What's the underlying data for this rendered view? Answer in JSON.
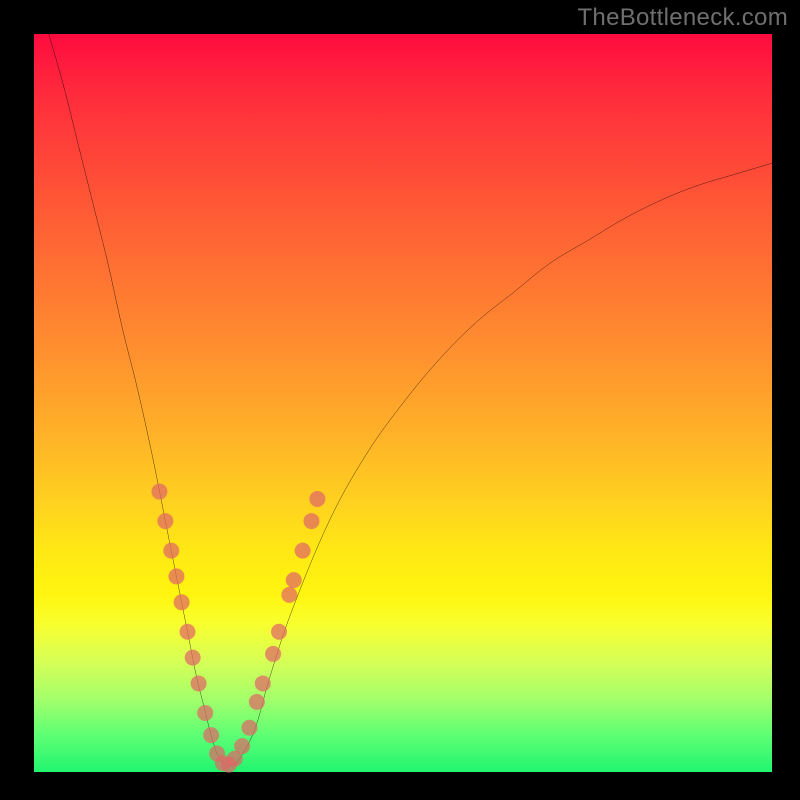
{
  "watermark": "TheBottleneck.com",
  "chart_data": {
    "type": "line",
    "title": "",
    "xlabel": "",
    "ylabel": "",
    "xlim": [
      0,
      100
    ],
    "ylim": [
      0,
      100
    ],
    "series": [
      {
        "name": "bottleneck-curve",
        "color": "#000000",
        "x": [
          2,
          4,
          6,
          8,
          10,
          12,
          14,
          16,
          18,
          19,
          20,
          21,
          22,
          23,
          24,
          25,
          26,
          27,
          28,
          30,
          32,
          35,
          40,
          45,
          50,
          55,
          60,
          65,
          70,
          75,
          80,
          85,
          90,
          95,
          100
        ],
        "y": [
          100,
          93,
          85,
          77,
          69,
          60,
          52,
          43,
          33,
          28,
          23,
          18,
          13,
          9,
          5,
          2,
          1,
          1,
          2,
          6,
          13,
          22,
          34,
          43,
          50,
          56,
          61,
          65,
          69,
          72,
          75,
          77.5,
          79.5,
          81,
          82.5
        ]
      }
    ],
    "markers": {
      "name": "highlight-points",
      "color": "#e06666",
      "radius": 8,
      "points": [
        {
          "x": 17.0,
          "y": 38
        },
        {
          "x": 17.8,
          "y": 34
        },
        {
          "x": 18.6,
          "y": 30
        },
        {
          "x": 19.3,
          "y": 26.5
        },
        {
          "x": 20.0,
          "y": 23
        },
        {
          "x": 20.8,
          "y": 19
        },
        {
          "x": 21.5,
          "y": 15.5
        },
        {
          "x": 22.3,
          "y": 12
        },
        {
          "x": 23.2,
          "y": 8
        },
        {
          "x": 24.0,
          "y": 5
        },
        {
          "x": 24.8,
          "y": 2.5
        },
        {
          "x": 25.6,
          "y": 1.2
        },
        {
          "x": 26.4,
          "y": 1.0
        },
        {
          "x": 27.2,
          "y": 1.8
        },
        {
          "x": 28.2,
          "y": 3.5
        },
        {
          "x": 29.2,
          "y": 6.0
        },
        {
          "x": 30.2,
          "y": 9.5
        },
        {
          "x": 31.0,
          "y": 12
        },
        {
          "x": 32.4,
          "y": 16
        },
        {
          "x": 33.2,
          "y": 19
        },
        {
          "x": 34.6,
          "y": 24
        },
        {
          "x": 35.2,
          "y": 26
        },
        {
          "x": 36.4,
          "y": 30
        },
        {
          "x": 37.6,
          "y": 34
        },
        {
          "x": 38.4,
          "y": 37
        }
      ]
    }
  }
}
